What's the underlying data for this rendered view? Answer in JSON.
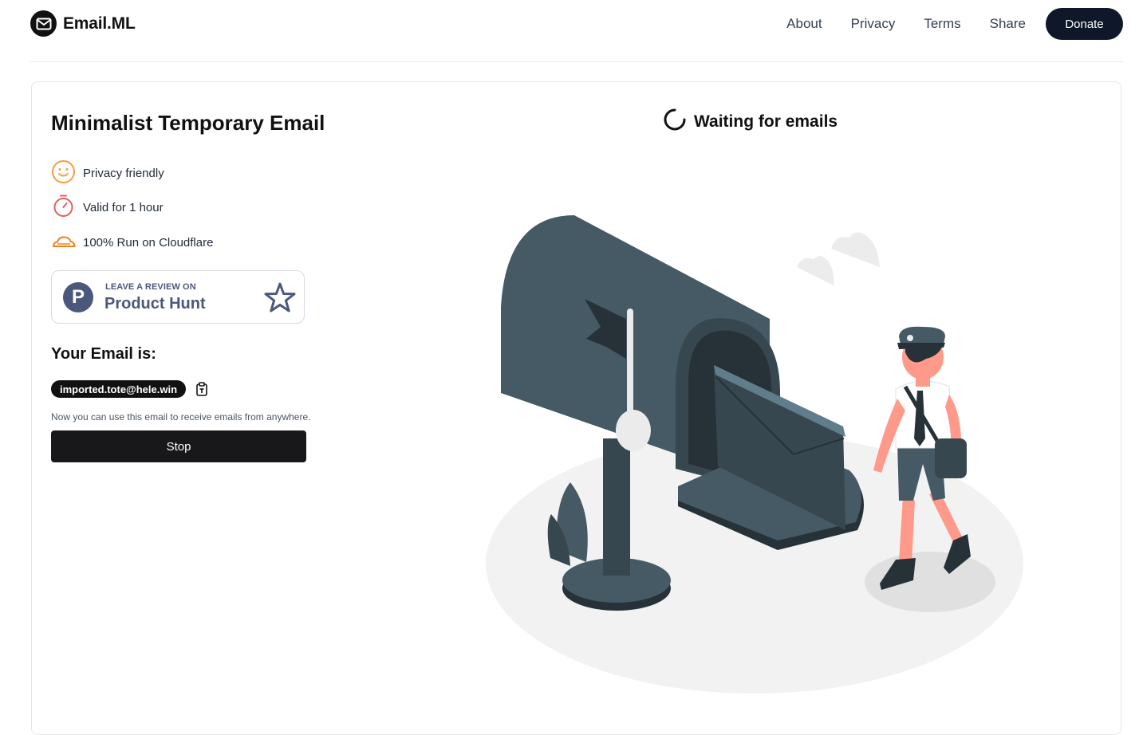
{
  "header": {
    "brand": "Email.ML",
    "nav": [
      "About",
      "Privacy",
      "Terms",
      "Share"
    ],
    "donate": "Donate"
  },
  "main": {
    "title": "Minimalist Temporary Email",
    "features": [
      {
        "label": "Privacy friendly",
        "icon": "smile-icon",
        "color": "#f59e42"
      },
      {
        "label": "Valid for 1 hour",
        "icon": "stopwatch-icon",
        "color": "#e85d5d"
      },
      {
        "label": "100% Run on Cloudflare",
        "icon": "cloudflare-icon",
        "color": "#f38020"
      }
    ],
    "product_hunt": {
      "small": "LEAVE A REVIEW ON",
      "big": "Product Hunt",
      "logo_letter": "P"
    },
    "email_heading": "Your Email is:",
    "email": "imported.tote@hele.win",
    "hint": "Now you can use this email to receive emails from anywhere.",
    "stop": "Stop"
  },
  "inbox": {
    "status": "Waiting for emails"
  },
  "colors": {
    "dark": "#111111",
    "product_hunt": "#4b587c",
    "mailbox": "#455a64",
    "skin": "#ff9a8b"
  }
}
